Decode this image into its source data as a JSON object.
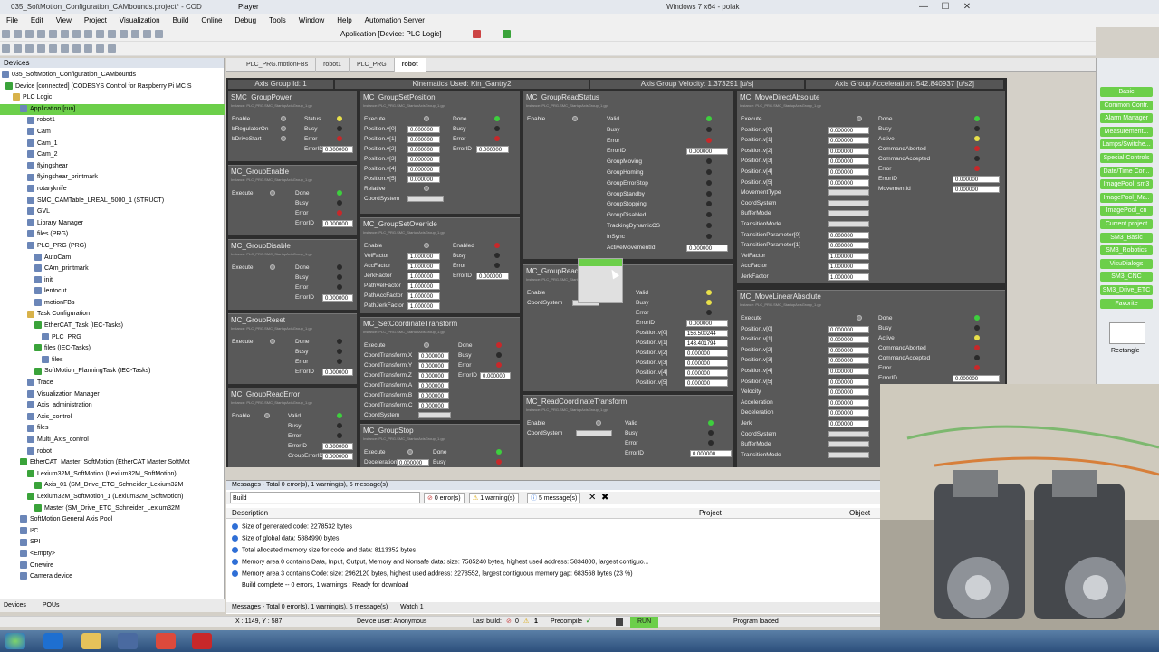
{
  "titlebar": {
    "title": "035_SoftMotion_Configuration_CAMbounds.project* - COD",
    "player": "Player",
    "center": "Windows 7 x64 - polak"
  },
  "menu": [
    "File",
    "Edit",
    "View",
    "Project",
    "Visualization",
    "Build",
    "Online",
    "Debug",
    "Tools",
    "Window",
    "Help",
    "Automation Server"
  ],
  "toolbar": {
    "application": "Application [Device: PLC Logic]"
  },
  "devices": {
    "title": "Devices",
    "items": [
      {
        "label": "035_SoftMotion_Configuration_CAMbounds",
        "cls": ""
      },
      {
        "label": "Device [connected] (CODESYS Control for Raspberry Pi MC S",
        "cls": "grn"
      },
      {
        "label": "PLC Logic",
        "cls": "fold"
      },
      {
        "label": "Application [run]",
        "cls": "sel"
      },
      {
        "label": "robot1",
        "cls": ""
      },
      {
        "label": "Cam",
        "cls": ""
      },
      {
        "label": "Cam_1",
        "cls": ""
      },
      {
        "label": "Cam_2",
        "cls": ""
      },
      {
        "label": "flyingshear",
        "cls": ""
      },
      {
        "label": "flyingshear_printmark",
        "cls": ""
      },
      {
        "label": "rotaryknife",
        "cls": ""
      },
      {
        "label": "SMC_CAMTable_LREAL_5000_1 (STRUCT)",
        "cls": ""
      },
      {
        "label": "GVL",
        "cls": ""
      },
      {
        "label": "Library Manager",
        "cls": ""
      },
      {
        "label": "files (PRG)",
        "cls": ""
      },
      {
        "label": "PLC_PRG (PRG)",
        "cls": ""
      },
      {
        "label": "AutoCam",
        "cls": ""
      },
      {
        "label": "CAm_printmark",
        "cls": ""
      },
      {
        "label": "init",
        "cls": ""
      },
      {
        "label": "lentocut",
        "cls": ""
      },
      {
        "label": "motionFBs",
        "cls": ""
      },
      {
        "label": "Task Configuration",
        "cls": "fold"
      },
      {
        "label": "EtherCAT_Task (IEC-Tasks)",
        "cls": "grn"
      },
      {
        "label": "PLC_PRG",
        "cls": ""
      },
      {
        "label": "files (IEC-Tasks)",
        "cls": "grn"
      },
      {
        "label": "files",
        "cls": ""
      },
      {
        "label": "SoftMotion_PlanningTask (IEC-Tasks)",
        "cls": "grn"
      },
      {
        "label": "Trace",
        "cls": ""
      },
      {
        "label": "Visualization Manager",
        "cls": ""
      },
      {
        "label": "Axis_administration",
        "cls": ""
      },
      {
        "label": "Axis_control",
        "cls": ""
      },
      {
        "label": "files",
        "cls": ""
      },
      {
        "label": "Multi_Axis_control",
        "cls": ""
      },
      {
        "label": "robot",
        "cls": ""
      },
      {
        "label": "EtherCAT_Master_SoftMotion (EtherCAT Master SoftMot",
        "cls": "grn"
      },
      {
        "label": "Lexium32M_SoftMotion (Lexium32M_SoftMotion)",
        "cls": "grn"
      },
      {
        "label": "Axis_01 (SM_Drive_ETC_Schneider_Lexium32M",
        "cls": "grn"
      },
      {
        "label": "Lexium32M_SoftMotion_1 (Lexium32M_SoftMotion)",
        "cls": "grn"
      },
      {
        "label": "Master (SM_Drive_ETC_Schneider_Lexium32M",
        "cls": "grn"
      },
      {
        "label": "SoftMotion General Axis Pool",
        "cls": ""
      },
      {
        "label": "I²C",
        "cls": ""
      },
      {
        "label": "SPI",
        "cls": ""
      },
      {
        "label": "<Empty>",
        "cls": ""
      },
      {
        "label": "Onewire",
        "cls": ""
      },
      {
        "label": "Camera device",
        "cls": ""
      }
    ],
    "bottom_tabs": [
      "Devices",
      "POUs"
    ]
  },
  "editor_tabs": [
    "PLC_PRG.motionFBs",
    "robot1",
    "PLC_PRG",
    "robot"
  ],
  "visu": {
    "axis_group": "Axis Group Id: 1",
    "kinematics": "Kinematics Used: Kin_Gantry2",
    "velocity": "Axis Group Velocity: 1.373291 [u/s]",
    "acceleration": "Axis Group Acceleration: 542.840937 [u/s2]",
    "zero": "0.000000",
    "pos0": "156.500244",
    "pos1": "143.401794",
    "one": "1.000000",
    "sub": "Instance: PLC_PRG.SMC_StartupAxisGroup_1.gp",
    "blocks": {
      "power": "SMC_GroupPower",
      "enable": "MC_GroupEnable",
      "disable": "MC_GroupDisable",
      "reset": "MC_GroupReset",
      "readerror": "MC_GroupReadError",
      "setpos": "MC_GroupSetPosition",
      "setoverride": "MC_GroupSetOverride",
      "setct": "MC_SetCoordinateTransform",
      "stop": "MC_GroupStop",
      "readstatus": "MC_GroupReadStatus",
      "readactpos": "MC_GroupReadA",
      "readct": "MC_ReadCoordinateTransform",
      "movedirect": "MC_MoveDirectAbsolute",
      "movelinear": "MC_MoveLinearAbsolute"
    }
  },
  "messages": {
    "header": "Messages - Total 0 error(s), 1 warning(s), 5 message(s)",
    "filter": "Build",
    "errors": "0 error(s)",
    "warnings": "1 warning(s)",
    "msgs": "5 message(s)",
    "cols": [
      "Description",
      "Project",
      "Object"
    ],
    "rows": [
      "Size of generated code: 2278532 bytes",
      "Size of global data: 5884990 bytes",
      "Total allocated memory size for code and data: 8113352 bytes",
      "Memory area 0 contains  Data, Input, Output, Memory and Nonsafe data: size: 7585240 bytes, highest used address: 5834800, largest contiguo...",
      "Memory area 3 contains  Code: size: 2962120 bytes, highest used address: 2278552, largest contiguous memory gap: 683568 bytes (23 %)",
      "Build complete -- 0 errors, 1 warnings : Ready for download"
    ],
    "tab1": "Messages - Total 0 error(s), 1 warning(s), 5 message(s)",
    "tab2": "Watch 1"
  },
  "status": {
    "coords": "X : 1149, Y : 587",
    "user": "Device user: Anonymous",
    "lastbuild": "Last build:",
    "zero": "0",
    "one": "1",
    "precompile": "Precompile",
    "run": "RUN",
    "program": "Program loaded"
  },
  "toolbox": [
    "Basic",
    "Common Contr.",
    "Alarm Manager",
    "Measurement...",
    "Lamps/Switche...",
    "Special Controls",
    "Date/Time Con..",
    "ImagePool_sm3",
    "ImagePool_Ma..",
    "ImagePool_cn",
    "Current project",
    "SM3_Basic",
    "SM3_Robotics",
    "VisuDialogs",
    "SM3_CNC",
    "SM3_Drive_ETC",
    "Favorite"
  ],
  "toolbox_tool": "Rectangle",
  "colors": {
    "accent": "#6ccf4a",
    "visbg": "#2d2d2d"
  }
}
